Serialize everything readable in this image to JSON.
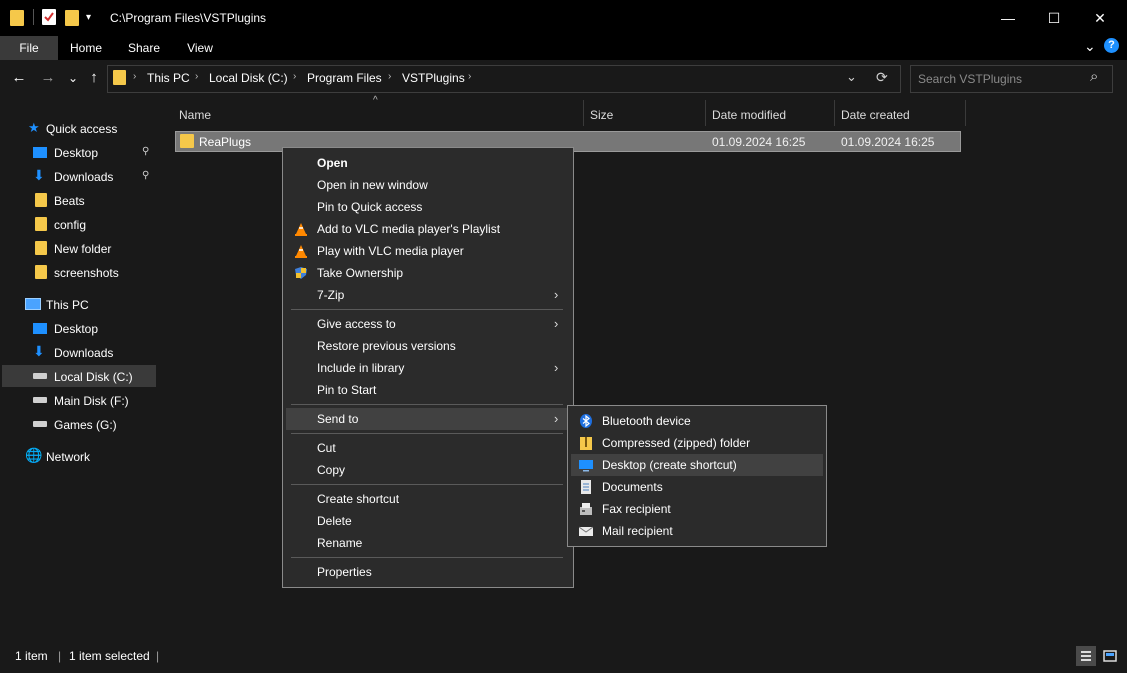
{
  "window": {
    "path_title": "C:\\Program Files\\VSTPlugins",
    "minimize_glyph": "—",
    "maximize_glyph": "☐",
    "close_glyph": "✕"
  },
  "ribbon": {
    "tabs": [
      "File",
      "Home",
      "Share",
      "View"
    ],
    "expand_glyph": "⌄",
    "help_glyph": "?"
  },
  "navigation": {
    "back_glyph": "←",
    "forward_glyph": "→",
    "recent_glyph": "⌄",
    "up_glyph": "↑",
    "breadcrumb": [
      "This PC",
      "Local Disk (C:)",
      "Program Files",
      "VSTPlugins"
    ],
    "separator": "›",
    "dropdown_glyph": "⌄",
    "refresh_glyph": "⟳",
    "search_placeholder": "Search VSTPlugins",
    "search_glyph": "⌕"
  },
  "sidebar": {
    "quick_access": {
      "label": "Quick access",
      "icon": "star-icon"
    },
    "quick_items": [
      {
        "label": "Desktop",
        "icon": "desktop-icon",
        "pinned": true
      },
      {
        "label": "Downloads",
        "icon": "download-icon",
        "pinned": true
      },
      {
        "label": "Beats",
        "icon": "folder-icon"
      },
      {
        "label": "config",
        "icon": "folder-icon"
      },
      {
        "label": "New folder",
        "icon": "folder-icon"
      },
      {
        "label": "screenshots",
        "icon": "folder-icon"
      }
    ],
    "this_pc": {
      "label": "This PC",
      "icon": "computer-icon"
    },
    "pc_items": [
      {
        "label": "Desktop",
        "icon": "desktop-icon"
      },
      {
        "label": "Downloads",
        "icon": "download-icon"
      },
      {
        "label": "Local Disk (C:)",
        "icon": "drive-icon",
        "selected": true
      },
      {
        "label": "Main Disk (F:)",
        "icon": "drive-icon"
      },
      {
        "label": "Games (G:)",
        "icon": "drive-icon"
      }
    ],
    "network": {
      "label": "Network",
      "icon": "network-icon"
    },
    "pin_glyph": "📌"
  },
  "file_list": {
    "columns": [
      "Name",
      "Size",
      "Date modified",
      "Date created"
    ],
    "sort_glyph": "^",
    "rows": [
      {
        "name": "ReaPlugs",
        "size": "",
        "modified": "01.09.2024 16:25",
        "created": "01.09.2024 16:25"
      }
    ]
  },
  "context_menu": {
    "groups": [
      [
        {
          "label": "Open",
          "bold": true
        },
        {
          "label": "Open in new window"
        },
        {
          "label": "Pin to Quick access"
        },
        {
          "label": "Add to VLC media player's Playlist",
          "icon": "vlc-cone-icon"
        },
        {
          "label": "Play with VLC media player",
          "icon": "vlc-cone-icon"
        },
        {
          "label": "Take Ownership",
          "icon": "uac-shield-icon"
        },
        {
          "label": "7-Zip",
          "submenu": true
        }
      ],
      [
        {
          "label": "Give access to",
          "submenu": true
        },
        {
          "label": "Restore previous versions"
        },
        {
          "label": "Include in library",
          "submenu": true
        },
        {
          "label": "Pin to Start"
        }
      ],
      [
        {
          "label": "Send to",
          "submenu": true,
          "hover": true
        }
      ],
      [
        {
          "label": "Cut"
        },
        {
          "label": "Copy"
        }
      ],
      [
        {
          "label": "Create shortcut"
        },
        {
          "label": "Delete"
        },
        {
          "label": "Rename"
        }
      ],
      [
        {
          "label": "Properties"
        }
      ]
    ],
    "arrow_glyph": "›"
  },
  "send_to_menu": {
    "items": [
      {
        "label": "Bluetooth device",
        "icon": "bluetooth-icon"
      },
      {
        "label": "Compressed (zipped) folder",
        "icon": "zip-folder-icon"
      },
      {
        "label": "Desktop (create shortcut)",
        "icon": "desktop-icon",
        "hover": true
      },
      {
        "label": "Documents",
        "icon": "documents-icon"
      },
      {
        "label": "Fax recipient",
        "icon": "fax-icon"
      },
      {
        "label": "Mail recipient",
        "icon": "mail-icon"
      }
    ]
  },
  "status": {
    "item_count": "1 item",
    "selected_count": "1 item selected",
    "separator": "|"
  },
  "colors": {
    "accent_blue": "#1e90ff",
    "folder_yellow": "#f5c84a",
    "selection_gray": "#777777"
  }
}
